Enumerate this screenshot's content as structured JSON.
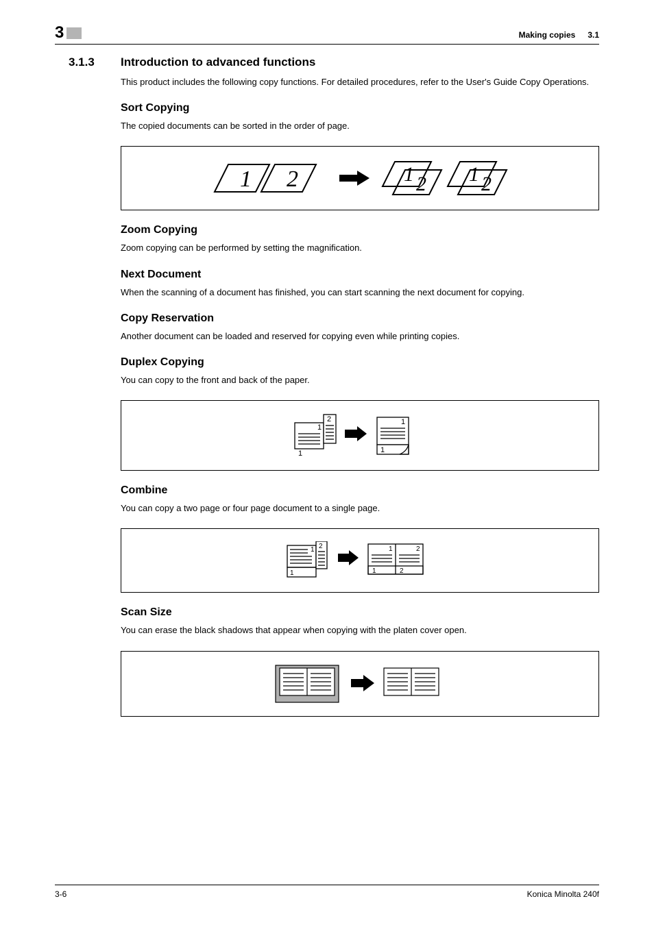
{
  "header": {
    "chapter_number": "3",
    "right_title": "Making copies",
    "right_section": "3.1"
  },
  "section": {
    "number": "3.1.3",
    "title": "Introduction to advanced functions",
    "intro": "This product includes the following copy functions. For detailed procedures, refer to the User's Guide Copy Operations."
  },
  "sort_copying": {
    "heading": "Sort Copying",
    "body": "The copied documents can be sorted in the order of page."
  },
  "zoom_copying": {
    "heading": "Zoom Copying",
    "body": "Zoom copying can be performed by setting the magnification."
  },
  "next_document": {
    "heading": "Next Document",
    "body": "When the scanning of a document has finished, you can start scanning the next document for copying."
  },
  "copy_reservation": {
    "heading": "Copy Reservation",
    "body": "Another document can be loaded and reserved for copying even while printing copies."
  },
  "duplex_copying": {
    "heading": "Duplex Copying",
    "body": "You can copy to the front and back of the paper."
  },
  "combine": {
    "heading": "Combine",
    "body": "You can copy a two page or four page document to a single page."
  },
  "scan_size": {
    "heading": "Scan Size",
    "body": "You can erase the black shadows that appear when copying with the platen cover open."
  },
  "footer": {
    "page": "3-6",
    "product": "Konica Minolta 240f"
  }
}
